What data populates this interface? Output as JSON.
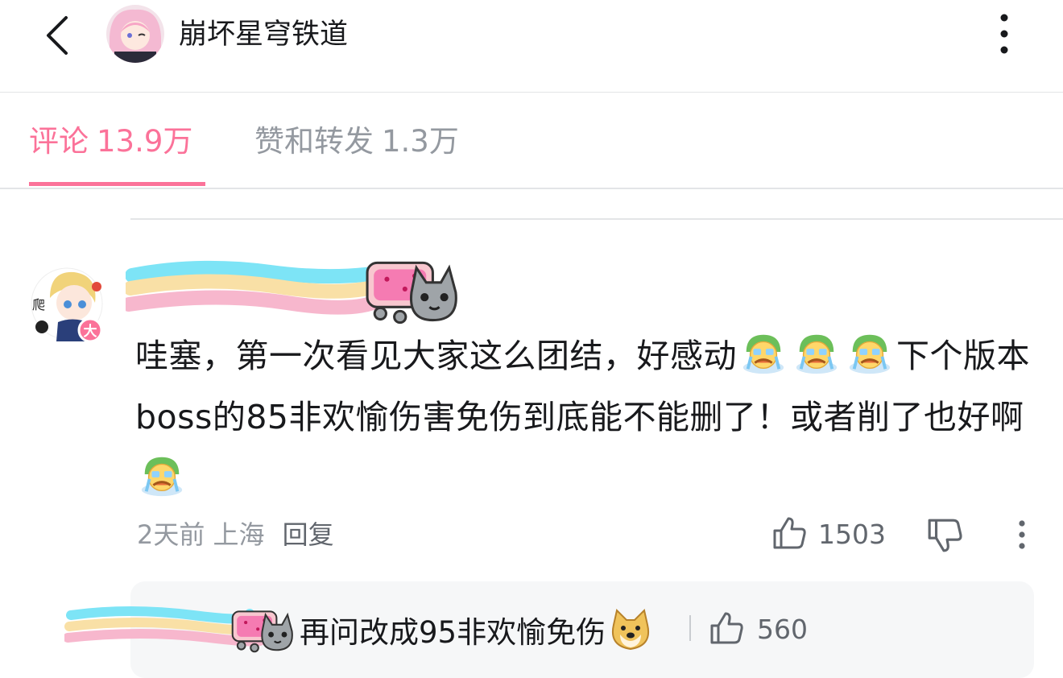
{
  "header": {
    "title": "崩坏星穹铁道"
  },
  "tabs": [
    {
      "label": "评论",
      "count": "13.9万",
      "active": true
    },
    {
      "label": "赞和转发",
      "count": "1.3万",
      "active": false
    }
  ],
  "colors": {
    "accent": "#fb7299",
    "muted": "#9499a0",
    "divider": "#e3e5e7"
  },
  "comment": {
    "avatar_badge": "大",
    "avatar_tag": "爬",
    "text_part1": "哇塞，第一次看见大家这么团结，好感动",
    "text_part2": "下个版本boss的85非欢愉伤害免伤到底能不能删了！或者削了也好啊",
    "time": "2天前",
    "location": "上海",
    "reply_label": "回复",
    "like_count": "1503",
    "emoji_count": 4
  },
  "sub_reply": {
    "text": "再问改成95非欢愉免伤",
    "like_count": "560"
  },
  "icons": [
    "back-chevron-icon",
    "more-vertical-icon",
    "thumbs-up-icon",
    "thumbs-down-icon",
    "crying-emoji-icon",
    "doge-emoji-icon",
    "nyan-cat-badge-icon"
  ]
}
